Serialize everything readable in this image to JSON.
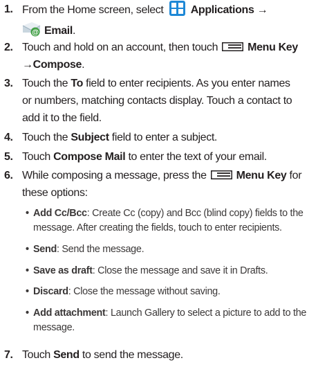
{
  "steps": [
    {
      "num": "1.",
      "t1": "From the Home screen, select",
      "b1": "Applications →",
      "b2": "Email",
      "t2": "."
    },
    {
      "num": "2.",
      "t1": "Touch and hold on an account, then touch",
      "b1": "Menu Key",
      "b2": "→Compose",
      "t2": "."
    },
    {
      "num": "3.",
      "t1": "Touch the",
      "b1": "To",
      "t2": "field to enter recipients. As you enter names",
      "line2": "or numbers, matching contacts display. Touch a contact to",
      "line3": "add it to the field."
    },
    {
      "num": "4.",
      "t1": "Touch the",
      "b1": "Subject",
      "t2": "field to enter a subject."
    },
    {
      "num": "5.",
      "t1": "Touch",
      "b1": "Compose Mail",
      "t2": "to enter the text of your email."
    },
    {
      "num": "6.",
      "t1": "While composing a message, press the",
      "b1": "Menu Key",
      "t2": "for",
      "line2": "these options:"
    },
    {
      "num": "7.",
      "t1": "Touch",
      "b1": "Send",
      "t2": "to send the message."
    }
  ],
  "options": [
    {
      "bullet": "•",
      "label": "Add Cc/Bcc",
      "desc": ": Create Cc (copy) and Bcc (blind copy) fields to the",
      "desc2": "message. After creating the fields, touch to enter recipients."
    },
    {
      "bullet": "•",
      "label": "Send",
      "desc": ": Send the message."
    },
    {
      "bullet": "•",
      "label": "Save as draft",
      "desc": ": Close the message and save it in Drafts."
    },
    {
      "bullet": "•",
      "label": "Discard",
      "desc": ": Close the message without saving."
    },
    {
      "bullet": "•",
      "label": "Add attachment",
      "desc": ": Launch Gallery to select a picture to add to the",
      "desc2": "message."
    }
  ],
  "icons": {
    "applications": "applications-icon",
    "email": "email-icon",
    "menu_key": "menu-key-icon"
  },
  "colors": {
    "text": "#231f20",
    "applications_icon": "#1e88d6"
  }
}
